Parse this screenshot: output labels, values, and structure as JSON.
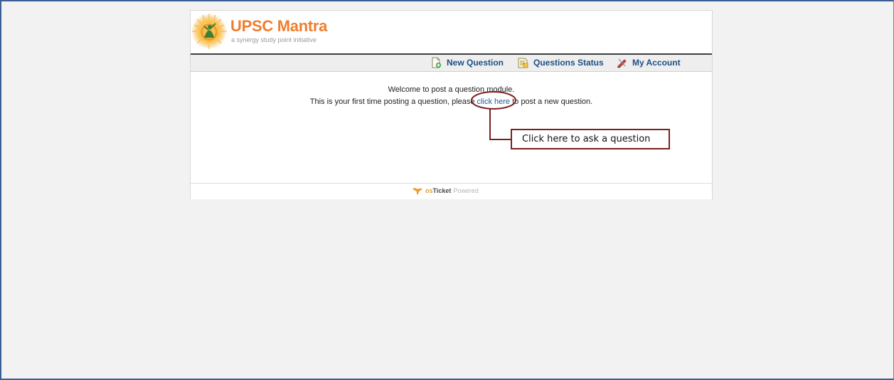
{
  "site": {
    "brand_name": "UPSC Mantra",
    "tagline": "a synergy study point initiative"
  },
  "nav": {
    "items": [
      {
        "label": "New Question",
        "icon": "new-document-icon"
      },
      {
        "label": "Questions Status",
        "icon": "document-status-icon"
      },
      {
        "label": "My Account",
        "icon": "account-pencil-icon"
      }
    ]
  },
  "content": {
    "welcome_text": "Welcome to post a question module.",
    "instruction_before": "This is your first time posting a question, please ",
    "link_text": "click here",
    "instruction_after": " to post a new question."
  },
  "annotation": {
    "callout_text": "Click here to ask a question",
    "color": "#7b1f1f"
  },
  "footer": {
    "brand_prefix": "os",
    "brand_suffix": "Ticket",
    "powered_text": "Powered",
    "icon": "kangaroo-logo-icon"
  },
  "colors": {
    "accent_orange": "#ef7e2e",
    "nav_link": "#1d4f85",
    "page_background": "#f2f2f2",
    "frame_border": "#3a5f95"
  }
}
